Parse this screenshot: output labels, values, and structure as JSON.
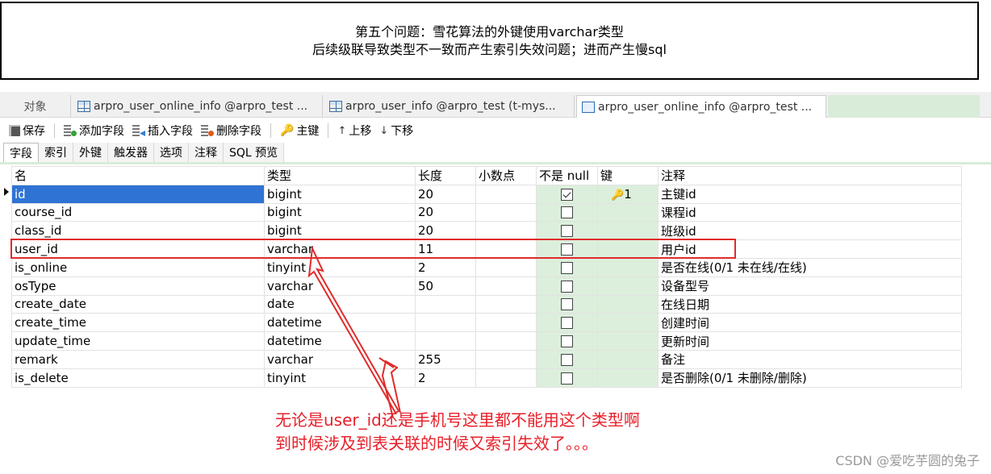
{
  "note": {
    "line1": "第五个问题：雪花算法的外键使用varchar类型",
    "line2": "后续级联导致类型不一致而产生索引失效问题；进而产生慢sql"
  },
  "tabs": {
    "objects": "对象",
    "items": [
      "arpro_user_online_info @arpro_test ...",
      "arpro_user_info @arpro_test (t-mys...",
      "arpro_user_online_info @arpro_test ..."
    ]
  },
  "toolbar": {
    "save": "保存",
    "add_field": "添加字段",
    "insert_field": "插入字段",
    "delete_field": "删除字段",
    "primary_key": "主键",
    "move_up": "上移",
    "move_down": "下移"
  },
  "subtabs": [
    "字段",
    "索引",
    "外键",
    "触发器",
    "选项",
    "注释",
    "SQL 预览"
  ],
  "grid": {
    "headers": {
      "name": "名",
      "type": "类型",
      "length": "长度",
      "decimal": "小数点",
      "not_null": "不是 null",
      "key": "键",
      "comment": "注释"
    },
    "rows": [
      {
        "name": "id",
        "type": "bigint",
        "length": "20",
        "decimal": "",
        "not_null": true,
        "key": "1",
        "comment": "主键id"
      },
      {
        "name": "course_id",
        "type": "bigint",
        "length": "20",
        "decimal": "",
        "not_null": false,
        "key": "",
        "comment": "课程id"
      },
      {
        "name": "class_id",
        "type": "bigint",
        "length": "20",
        "decimal": "",
        "not_null": false,
        "key": "",
        "comment": "班级id"
      },
      {
        "name": "user_id",
        "type": "varchar",
        "length": "11",
        "decimal": "",
        "not_null": false,
        "key": "",
        "comment": "用户id"
      },
      {
        "name": "is_online",
        "type": "tinyint",
        "length": "2",
        "decimal": "",
        "not_null": false,
        "key": "",
        "comment": "是否在线(0/1 未在线/在线)"
      },
      {
        "name": "osType",
        "type": "varchar",
        "length": "50",
        "decimal": "",
        "not_null": false,
        "key": "",
        "comment": "设备型号"
      },
      {
        "name": "create_date",
        "type": "date",
        "length": "",
        "decimal": "",
        "not_null": false,
        "key": "",
        "comment": "在线日期"
      },
      {
        "name": "create_time",
        "type": "datetime",
        "length": "",
        "decimal": "",
        "not_null": false,
        "key": "",
        "comment": "创建时间"
      },
      {
        "name": "update_time",
        "type": "datetime",
        "length": "",
        "decimal": "",
        "not_null": false,
        "key": "",
        "comment": "更新时间"
      },
      {
        "name": "remark",
        "type": "varchar",
        "length": "255",
        "decimal": "",
        "not_null": false,
        "key": "",
        "comment": "备注"
      },
      {
        "name": "is_delete",
        "type": "tinyint",
        "length": "2",
        "decimal": "",
        "not_null": false,
        "key": "",
        "comment": "是否删除(0/1 未删除/删除)"
      }
    ]
  },
  "annotation": {
    "line1": "无论是user_id还是手机号这里都不能用这个类型啊",
    "line2": "到时候涉及到表关联的时候又索引失效了。。。"
  },
  "watermark": "CSDN @爱吃芋圆的兔子",
  "colors": {
    "annotation_red": "#e8202a",
    "selection_blue": "#2f73d4",
    "notnull_green": "#dcefdc"
  }
}
